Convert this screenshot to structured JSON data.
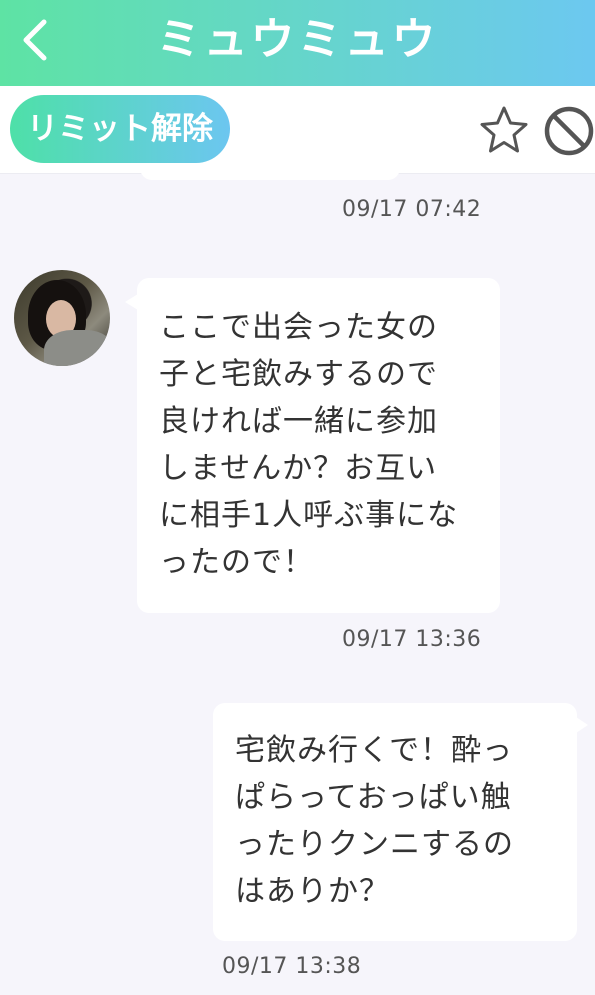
{
  "header": {
    "title": "ミュウミュウ",
    "back_icon": "chevron-left-icon"
  },
  "toolbar": {
    "limit_button_label": "リミット解除",
    "favorite_icon": "star-outline-icon",
    "block_icon": "block-icon"
  },
  "messages": [
    {
      "direction": "incoming-partial",
      "timestamp": "09/17 07:42"
    },
    {
      "direction": "incoming",
      "lines": [
        "ここで出会った女の",
        "子と宅飲みするので",
        "良ければ一緒に参加",
        "しませんか？お互い",
        "に相手1人呼ぶ事にな",
        "ったので！"
      ],
      "timestamp": "09/17 13:36"
    },
    {
      "direction": "outgoing",
      "lines": [
        "宅飲み行くで！酔っ",
        "ぱらっておっぱい触",
        "ったりクンニするの",
        "はありか？"
      ],
      "timestamp": "09/17 13:38"
    }
  ],
  "colors": {
    "header_gradient_start": "#5ee3a4",
    "header_gradient_end": "#6cc8f0",
    "chat_background": "#f6f5fb",
    "bubble": "#ffffff"
  }
}
